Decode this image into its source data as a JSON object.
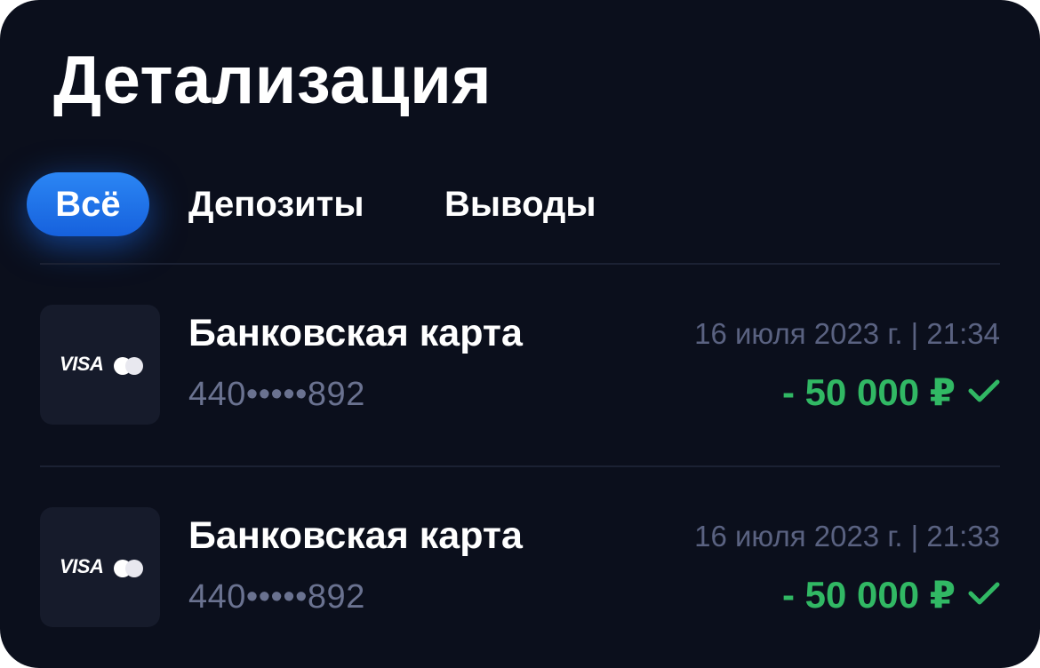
{
  "header": {
    "title": "Детализация"
  },
  "tabs": [
    {
      "label": "Всё",
      "active": true
    },
    {
      "label": "Депозиты",
      "active": false
    },
    {
      "label": "Выводы",
      "active": false
    }
  ],
  "transactions": [
    {
      "card_brand_label": "VISA",
      "method": "Банковская карта",
      "card_number": "440•••••892",
      "datetime": "16 июля 2023 г. | 21:34",
      "amount": "- 50 000 ₽",
      "status_icon": "check-icon"
    },
    {
      "card_brand_label": "VISA",
      "method": "Банковская карта",
      "card_number": "440•••••892",
      "datetime": "16 июля 2023 г. | 21:33",
      "amount": "- 50 000 ₽",
      "status_icon": "check-icon"
    }
  ],
  "colors": {
    "background": "#0b0f1c",
    "accent": "#1f73ea",
    "success": "#31b864",
    "muted_text": "#6a7290"
  }
}
